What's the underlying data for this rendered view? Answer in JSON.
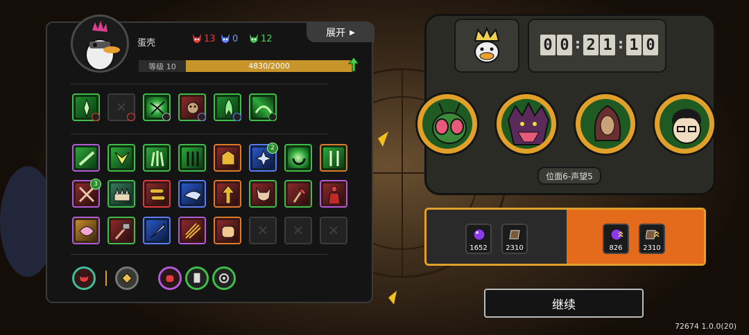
{
  "player": {
    "name": "蛋壳",
    "level_label": "等级 10",
    "xp_text": "4830/2000",
    "xp_progress": 0.97
  },
  "resources": [
    {
      "name": "red-demon",
      "value": "13",
      "color": "#e23b3b"
    },
    {
      "name": "blue-demon",
      "value": "0",
      "color": "#5b7cf0"
    },
    {
      "name": "green-demon",
      "value": "12",
      "color": "#3fbf4a"
    }
  ],
  "expand_label": "展开",
  "equipped_row": [
    {
      "name": "green-spike-skill-slot",
      "dot": true
    },
    {
      "name": "empty-skill-slot",
      "dot": true
    },
    {
      "name": "claw-burst-skill-slot",
      "dot": true
    },
    {
      "name": "beast-skill-slot",
      "dot": true
    },
    {
      "name": "green-flame-skill-slot",
      "dot": true
    },
    {
      "name": "green-wave-skill-slot",
      "dot": true
    }
  ],
  "inventory_badges": {
    "blue-burst": "2",
    "crossed-swords": "3"
  },
  "bottom_row": [
    "demon-emblem",
    "owl-emblem",
    "fist-skill",
    "scroll-skill",
    "spiral-skill"
  ],
  "timer": {
    "digits": [
      "0",
      "0",
      "2",
      "1",
      "1",
      "0"
    ]
  },
  "opponents": [
    "fly-monster",
    "spiked-beast",
    "hooded-creature",
    "curly-hair-boy"
  ],
  "location": "位面6-声望5",
  "rewards_left": [
    {
      "icon": "purple-orb",
      "qty": "1652"
    },
    {
      "icon": "brown-card",
      "qty": "2310"
    }
  ],
  "rewards_right": [
    {
      "icon": "purple-orb-up",
      "qty": "826"
    },
    {
      "icon": "brown-card-up",
      "qty": "2310"
    }
  ],
  "continue_label": "继续",
  "version": "72674 1.0.0(20)"
}
